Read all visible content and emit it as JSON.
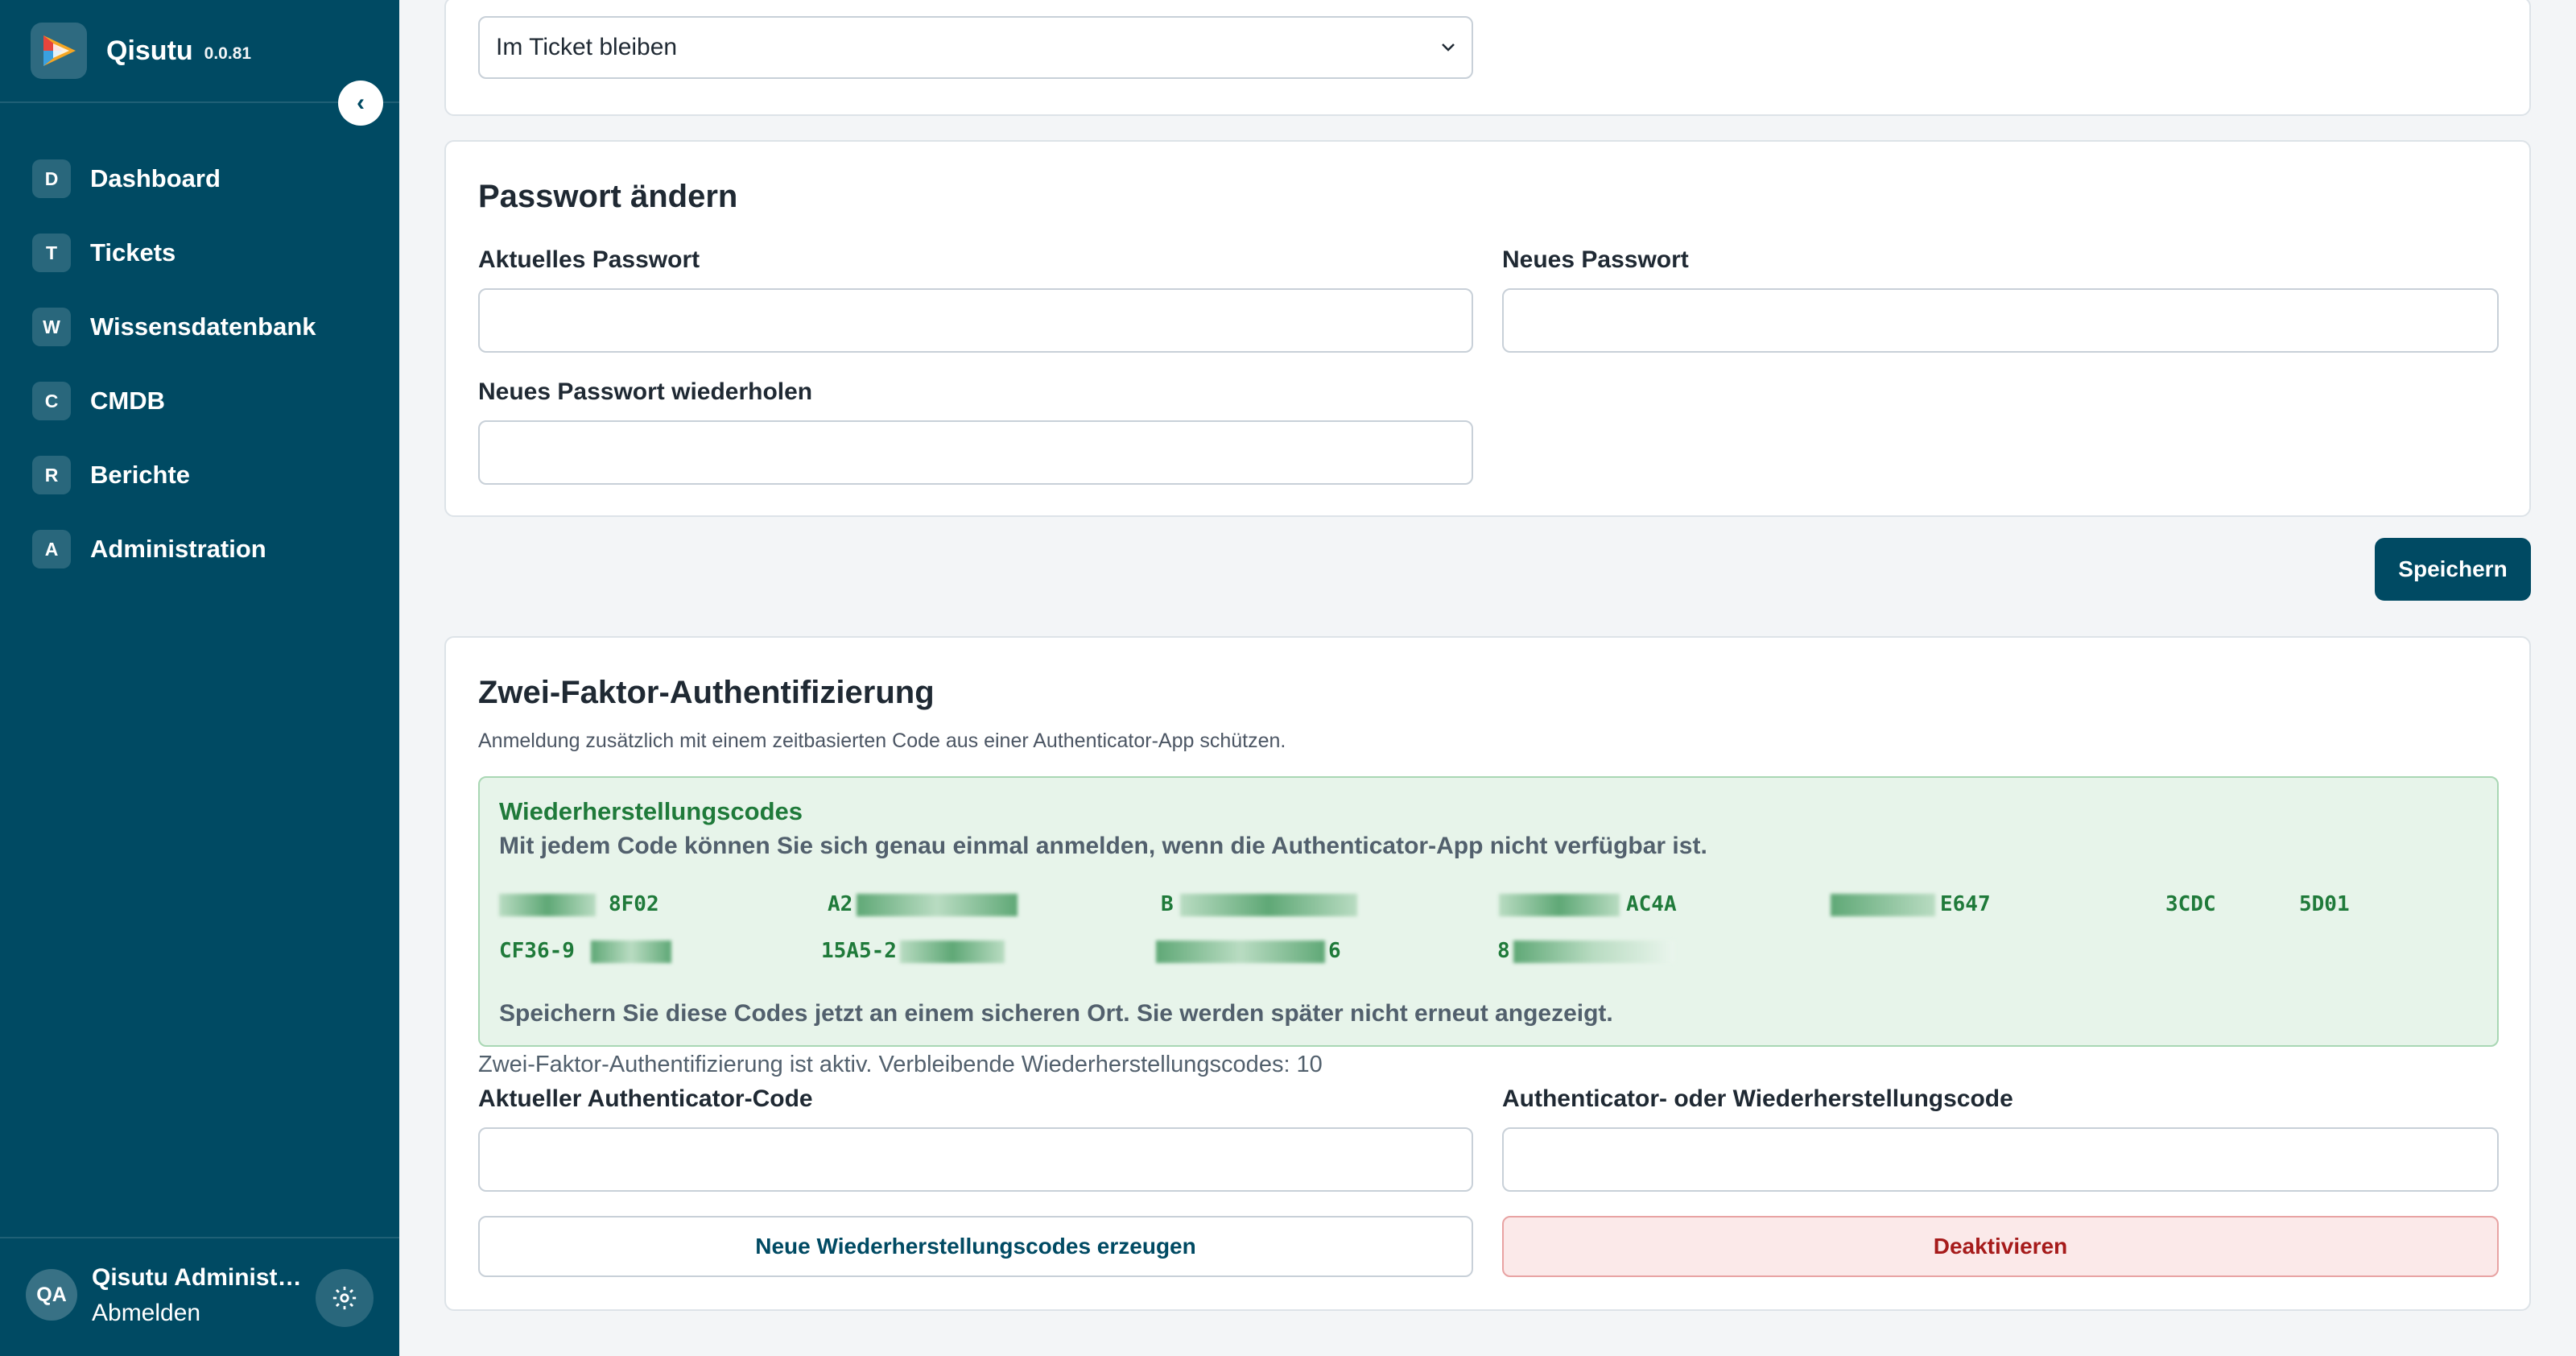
{
  "app": {
    "name": "Qisutu",
    "version": "0.0.81"
  },
  "sidebar": {
    "collapse_icon": "chevron-left-icon",
    "items": [
      {
        "badge": "D",
        "label": "Dashboard"
      },
      {
        "badge": "T",
        "label": "Tickets"
      },
      {
        "badge": "W",
        "label": "Wissensdatenbank"
      },
      {
        "badge": "C",
        "label": "CMDB"
      },
      {
        "badge": "R",
        "label": "Berichte"
      },
      {
        "badge": "A",
        "label": "Administration"
      }
    ],
    "user": {
      "initials": "QA",
      "name": "Qisutu Administrator",
      "logout": "Abmelden"
    }
  },
  "after_save": {
    "selected": "Im Ticket bleiben"
  },
  "password": {
    "title": "Passwort ändern",
    "current_label": "Aktuelles Passwort",
    "new_label": "Neues Passwort",
    "repeat_label": "Neues Passwort wiederholen",
    "save": "Speichern"
  },
  "tfa": {
    "title": "Zwei-Faktor-Authentifizierung",
    "description": "Anmeldung zusätzlich mit einem zeitbasierten Code aus einer Authenticator-App schützen.",
    "recovery": {
      "title": "Wiederherstellungscodes",
      "text": "Mit jedem Code können Sie sich genau einmal anmelden, wenn die Authenticator-App nicht verfügbar ist.",
      "codes": [
        "8F02",
        "A2",
        "B",
        "AC4A",
        "E647",
        "3CDC",
        "5D01",
        "CF36-9",
        "15A5-2",
        "6",
        "8"
      ],
      "note": "Speichern Sie diese Codes jetzt an einem sicheren Ort. Sie werden später nicht erneut angezeigt."
    },
    "status": "Zwei-Faktor-Authentifizierung ist aktiv. Verbleibende Wiederherstellungscodes: 10",
    "current_code_label": "Aktueller Authenticator-Code",
    "recovery_code_label": "Authenticator- oder Wiederherstellungscode",
    "regenerate": "Neue Wiederherstellungscodes erzeugen",
    "deactivate": "Deaktivieren"
  },
  "colors": {
    "sidebar": "#004a63",
    "accent": "#004a63",
    "success": "#1f7a3a",
    "danger": "#a61b1b"
  }
}
